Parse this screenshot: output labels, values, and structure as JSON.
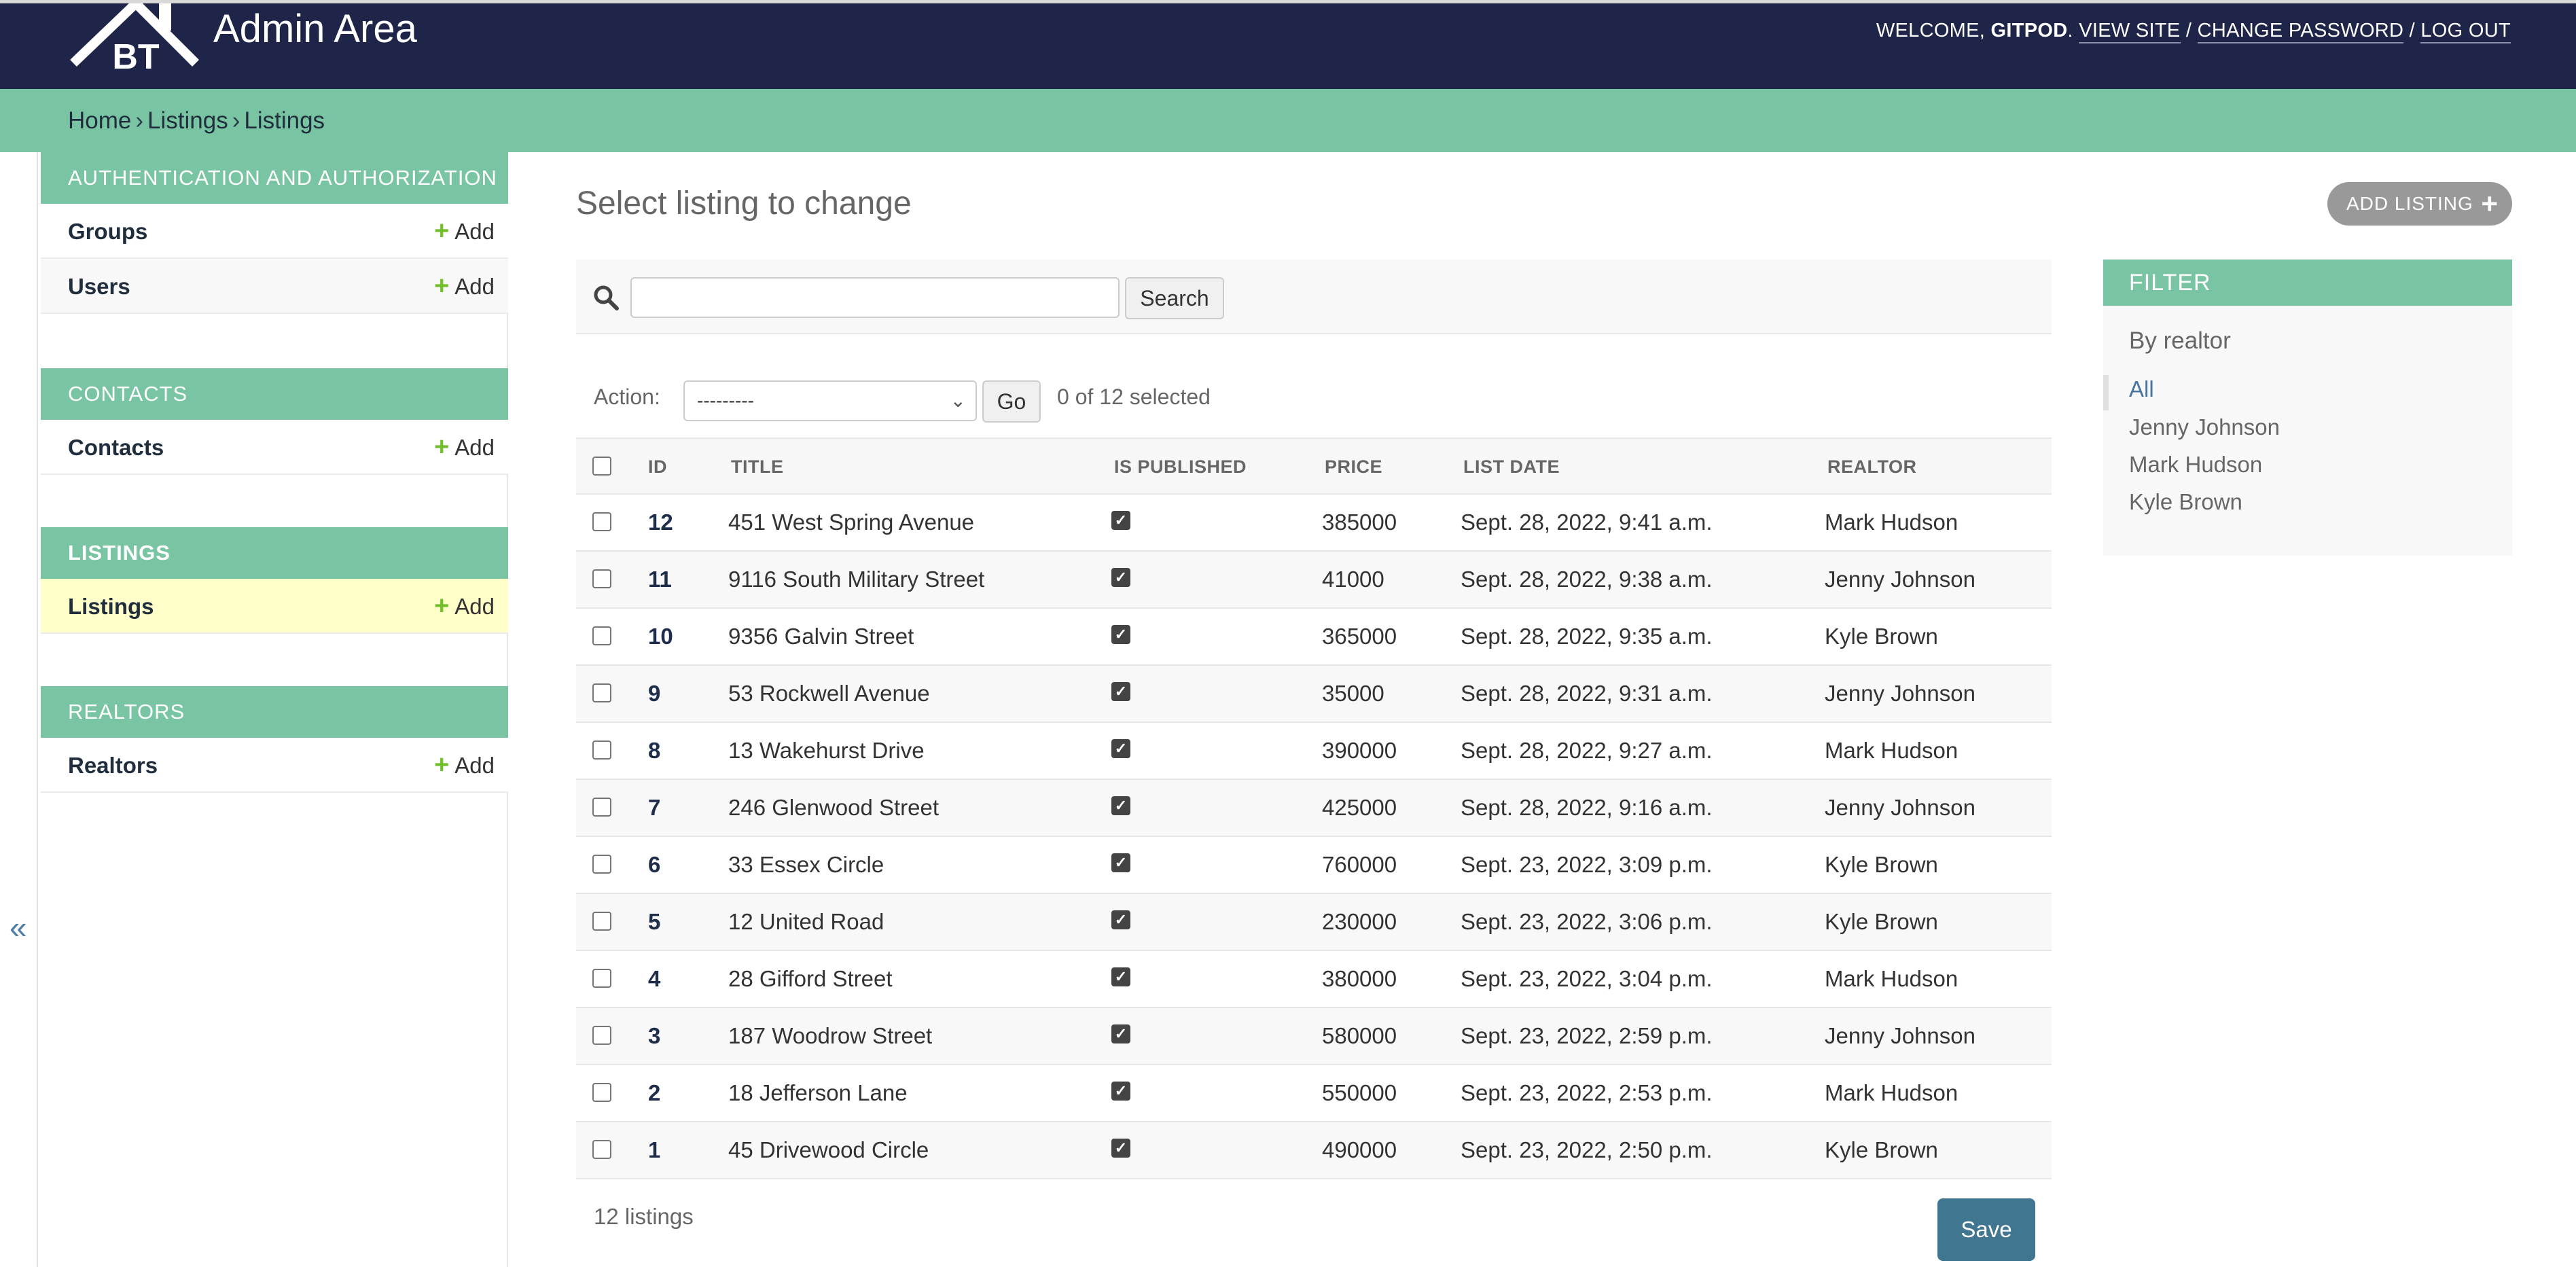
{
  "header": {
    "logo_text": "BT",
    "title": "Admin Area",
    "welcome_prefix": "WELCOME, ",
    "username": "GITPOD",
    "welcome_suffix": ".",
    "links": {
      "view_site": "VIEW SITE",
      "change_password": "CHANGE PASSWORD",
      "log_out": "LOG OUT"
    },
    "separator": "/"
  },
  "breadcrumbs": {
    "items": [
      "Home",
      "Listings",
      "Listings"
    ],
    "arrow": "›"
  },
  "sidebar": {
    "collapse_icon": "«",
    "modules": [
      {
        "caption": "AUTHENTICATION AND AUTHORIZATION",
        "rows": [
          {
            "label": "Groups",
            "add_label": "Add"
          },
          {
            "label": "Users",
            "add_label": "Add"
          }
        ]
      },
      {
        "caption": "CONTACTS",
        "rows": [
          {
            "label": "Contacts",
            "add_label": "Add"
          }
        ]
      },
      {
        "caption": "LISTINGS",
        "rows": [
          {
            "label": "Listings",
            "add_label": "Add"
          }
        ]
      },
      {
        "caption": "REALTORS",
        "rows": [
          {
            "label": "Realtors",
            "add_label": "Add"
          }
        ]
      }
    ]
  },
  "content": {
    "title": "Select listing to change",
    "add_button_label": "ADD LISTING",
    "add_icon": "plus-icon"
  },
  "search": {
    "value": "",
    "placeholder": "",
    "button_label": "Search",
    "icon": "search-icon"
  },
  "actions": {
    "label": "Action:",
    "selected_option": "---------",
    "go_label": "Go",
    "counter": "0 of 12 selected"
  },
  "table": {
    "columns": [
      "ID",
      "TITLE",
      "IS PUBLISHED",
      "PRICE",
      "LIST DATE",
      "REALTOR"
    ],
    "rows": [
      {
        "id": "12",
        "title": "451 West Spring Avenue",
        "published": true,
        "price": "385000",
        "list_date": "Sept. 28, 2022, 9:41 a.m.",
        "realtor": "Mark Hudson"
      },
      {
        "id": "11",
        "title": "9116 South Military Street",
        "published": true,
        "price": "41000",
        "list_date": "Sept. 28, 2022, 9:38 a.m.",
        "realtor": "Jenny Johnson"
      },
      {
        "id": "10",
        "title": "9356 Galvin Street",
        "published": true,
        "price": "365000",
        "list_date": "Sept. 28, 2022, 9:35 a.m.",
        "realtor": "Kyle Brown"
      },
      {
        "id": "9",
        "title": "53 Rockwell Avenue",
        "published": true,
        "price": "35000",
        "list_date": "Sept. 28, 2022, 9:31 a.m.",
        "realtor": "Jenny Johnson"
      },
      {
        "id": "8",
        "title": "13 Wakehurst Drive",
        "published": true,
        "price": "390000",
        "list_date": "Sept. 28, 2022, 9:27 a.m.",
        "realtor": "Mark Hudson"
      },
      {
        "id": "7",
        "title": "246 Glenwood Street",
        "published": true,
        "price": "425000",
        "list_date": "Sept. 28, 2022, 9:16 a.m.",
        "realtor": "Jenny Johnson"
      },
      {
        "id": "6",
        "title": "33 Essex Circle",
        "published": true,
        "price": "760000",
        "list_date": "Sept. 23, 2022, 3:09 p.m.",
        "realtor": "Kyle Brown"
      },
      {
        "id": "5",
        "title": "12 United Road",
        "published": true,
        "price": "230000",
        "list_date": "Sept. 23, 2022, 3:06 p.m.",
        "realtor": "Kyle Brown"
      },
      {
        "id": "4",
        "title": "28 Gifford Street",
        "published": true,
        "price": "380000",
        "list_date": "Sept. 23, 2022, 3:04 p.m.",
        "realtor": "Mark Hudson"
      },
      {
        "id": "3",
        "title": "187 Woodrow Street",
        "published": true,
        "price": "580000",
        "list_date": "Sept. 23, 2022, 2:59 p.m.",
        "realtor": "Jenny Johnson"
      },
      {
        "id": "2",
        "title": "18 Jefferson Lane",
        "published": true,
        "price": "550000",
        "list_date": "Sept. 23, 2022, 2:53 p.m.",
        "realtor": "Mark Hudson"
      },
      {
        "id": "1",
        "title": "45 Drivewood Circle",
        "published": true,
        "price": "490000",
        "list_date": "Sept. 23, 2022, 2:50 p.m.",
        "realtor": "Kyle Brown"
      }
    ],
    "paginator": "12 listings",
    "save_label": "Save"
  },
  "filter": {
    "title": "FILTER",
    "subtitle": "By realtor",
    "options": [
      "All",
      "Jenny Johnson",
      "Mark Hudson",
      "Kyle Brown"
    ],
    "selected": "All"
  },
  "colors": {
    "header_bg": "#1e2548",
    "accent_green": "#79c5a3",
    "save_button": "#417690",
    "add_plus": "#70bf2b",
    "current_row": "#ffffc9"
  }
}
